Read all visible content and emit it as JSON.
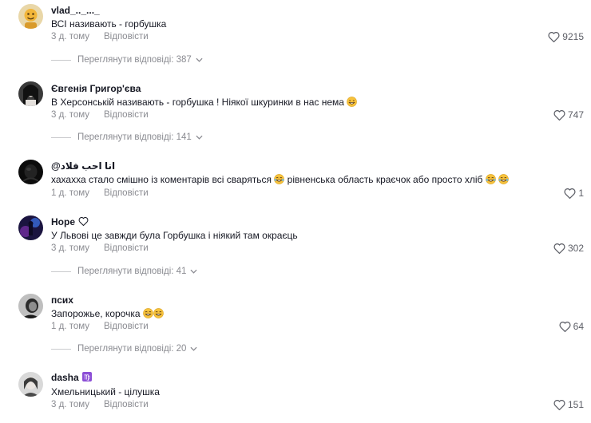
{
  "comments": [
    {
      "author": "vlad_.._..._",
      "text": "ВСІ називають - горбушка",
      "time": "3 д. тому",
      "reply": "Відповісти",
      "likes": "9215",
      "view_replies": "Переглянути відповіді: 387"
    },
    {
      "author": "Євгенія Григор'єва",
      "text": "В Херсонській називають - горбушка ! Ніякої шкуринки в нас нема",
      "time": "3 д. тому",
      "reply": "Відповісти",
      "likes": "747",
      "view_replies": "Переглянути відповіді: 141"
    },
    {
      "author": "@انا احب فلاد",
      "text": "хахахха стало смішно із коментарів всі сваряться",
      "text_2": "рівненська область краєчок або просто хліб",
      "time": "1 д. тому",
      "reply": "Відповісти",
      "likes": "1"
    },
    {
      "author": "Hope",
      "text": "У Львові це завжди була Горбушка і ніякий там окраєць",
      "time": "3 д. тому",
      "reply": "Відповісти",
      "likes": "302",
      "view_replies": "Переглянути відповіді: 41"
    },
    {
      "author": "псих",
      "text": "Запорожье, корочка",
      "time": "1 д. тому",
      "reply": "Відповісти",
      "likes": "64",
      "view_replies": "Переглянути відповіді: 20"
    },
    {
      "author": "dasha",
      "text": "Хмельницький - цілушка",
      "time": "3 д. тому",
      "reply": "Відповісти",
      "likes": "151"
    }
  ],
  "icons": {
    "like": "heart-outline-icon",
    "expand": "chevron-down-icon",
    "emoji": "grinning-face-emoji",
    "laugh": "tears-of-joy-emoji",
    "heart_badge": "white-heart-icon",
    "sign_badge": "virgo-sign-icon"
  },
  "colors": {
    "text": "#161823",
    "muted": "#8a8b91",
    "emoji": "#f7c23c",
    "virgo_badge": "#8c4fd6"
  }
}
